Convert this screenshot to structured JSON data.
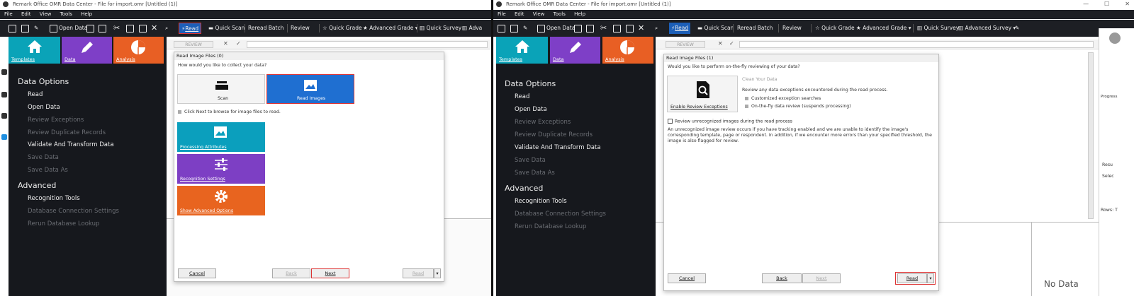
{
  "app": {
    "title": "Remark Office OMR Data Center - File for import.omr [Untitled (1)]",
    "menu": [
      "File",
      "Edit",
      "View",
      "Tools",
      "Help"
    ]
  },
  "toolbar": {
    "open_data": "Open Data",
    "read": "Read",
    "quick_scan": "Quick Scan",
    "reread_batch": "Reread Batch",
    "review": "Review",
    "quick_grade": "Quick Grade",
    "advanced_grade": "Advanced Grade",
    "quick_survey": "Quick Survey",
    "advanced_survey": "Advanced Survey",
    "advanced_survey_cut": "Adva",
    "review_button": "REVIEW"
  },
  "colors": {
    "templates": "#0aa3b8",
    "data": "#7e3fc7",
    "analysis": "#e85f24",
    "read_images": "#1f6fd1",
    "processing": "#0b9fbd",
    "recognition": "#7d3fc4",
    "advanced": "#e8641f",
    "highlight": "#d63333"
  },
  "tiles": {
    "templates": "Templates",
    "data": "Data",
    "analysis": "Analysis"
  },
  "nav": {
    "data_options": "Data Options",
    "read": "Read",
    "open_data": "Open Data",
    "review_exceptions": "Review Exceptions",
    "review_duplicates": "Review Duplicate Records",
    "validate": "Validate And Transform Data",
    "save_data": "Save Data",
    "save_data_as": "Save Data As",
    "advanced": "Advanced",
    "recognition_tools": "Recognition Tools",
    "db_settings": "Database Connection Settings",
    "rerun_lookup": "Rerun Database Lookup"
  },
  "dialog_left": {
    "title": "Read Image Files (0)",
    "question": "How would you like to collect your data?",
    "scan": "Scan",
    "read_images": "Read Images",
    "hint": "Click Next to browse for image files to read.",
    "processing": "Processing Attributes",
    "recognition": "Recognition Settings",
    "advanced": "Show Advanced Options",
    "cancel": "Cancel",
    "back": "Back",
    "next": "Next",
    "read": "Read"
  },
  "dialog_right": {
    "title": "Read Image Files (1)",
    "question": "Would you like to perform on-the-fly reviewing of your data?",
    "enable_review": "Enable Review Exceptions",
    "clean_heading": "Clean Your Data",
    "clean_desc": "Review any data exceptions encountered during the read process.",
    "bullet1": "Customized exception searches",
    "bullet2": "On-the-fly data review (suspends processing)",
    "checkbox": "Review unrecognized images during the read process",
    "para1": "An unrecognized image review occurs if you have tracking enabled and we are unable to identify the image's",
    "para2": "corresponding template, page or respondent. In addition, if we encounter more errors than your specified threshold, the",
    "para3": "image is also flagged for review.",
    "cancel": "Cancel",
    "back": "Back",
    "next": "Next",
    "read": "Read"
  },
  "right_side": {
    "no_data": "No Data",
    "side_labels": [
      "Progress",
      "Resu",
      "Selec",
      "Rows: T"
    ]
  }
}
